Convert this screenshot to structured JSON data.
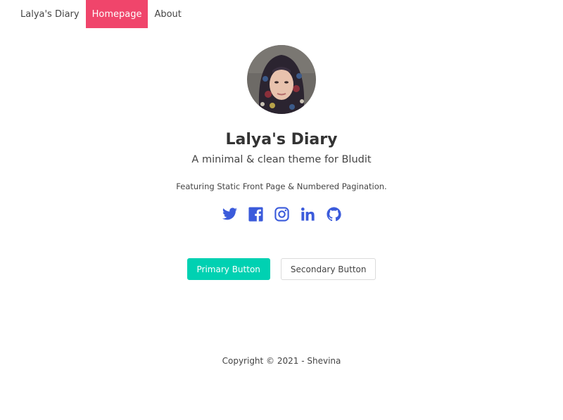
{
  "nav": {
    "items": [
      {
        "label": "Lalya's Diary",
        "active": false
      },
      {
        "label": "Homepage",
        "active": true
      },
      {
        "label": "About",
        "active": false
      }
    ]
  },
  "hero": {
    "title": "Lalya's Diary",
    "subtitle": "A minimal & clean theme for Bludit",
    "description": "Featuring Static Front Page & Numbered Pagination."
  },
  "social": {
    "color": "#3b5bdb",
    "icons": [
      "twitter-icon",
      "facebook-icon",
      "instagram-icon",
      "linkedin-icon",
      "github-icon"
    ]
  },
  "buttons": {
    "primary_label": "Primary Button",
    "secondary_label": "Secondary Button"
  },
  "footer": {
    "copyright": "Copyright © 2021 - Shevina"
  },
  "colors": {
    "nav_active_bg": "#f0456b",
    "primary_button": "#00d1b2"
  }
}
